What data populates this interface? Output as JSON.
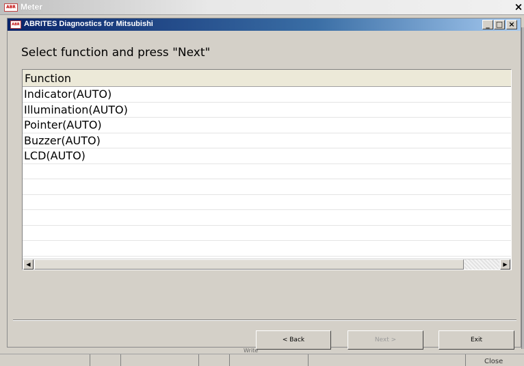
{
  "outer_window": {
    "title": "Meter",
    "close_glyph": "×"
  },
  "inner_window": {
    "title": "ABRITES Diagnostics for Mitsubishi",
    "controls": {
      "minimize": "_",
      "maximize": "□",
      "close": "×"
    }
  },
  "instruction": "Select function and press \"Next\"",
  "list": {
    "column_header": "Function",
    "items": [
      "Indicator(AUTO)",
      "Illumination(AUTO)",
      "Pointer(AUTO)",
      "Buzzer(AUTO)",
      "LCD(AUTO)"
    ],
    "scroll_left": "◀",
    "scroll_right": "▶"
  },
  "buttons": {
    "back": "< Back",
    "next": "Next >",
    "exit": "Exit"
  },
  "background": {
    "write_label": "Write",
    "close_label": "Close"
  },
  "icons": {
    "app_icon": "abrites-app-icon",
    "close": "close-icon"
  }
}
